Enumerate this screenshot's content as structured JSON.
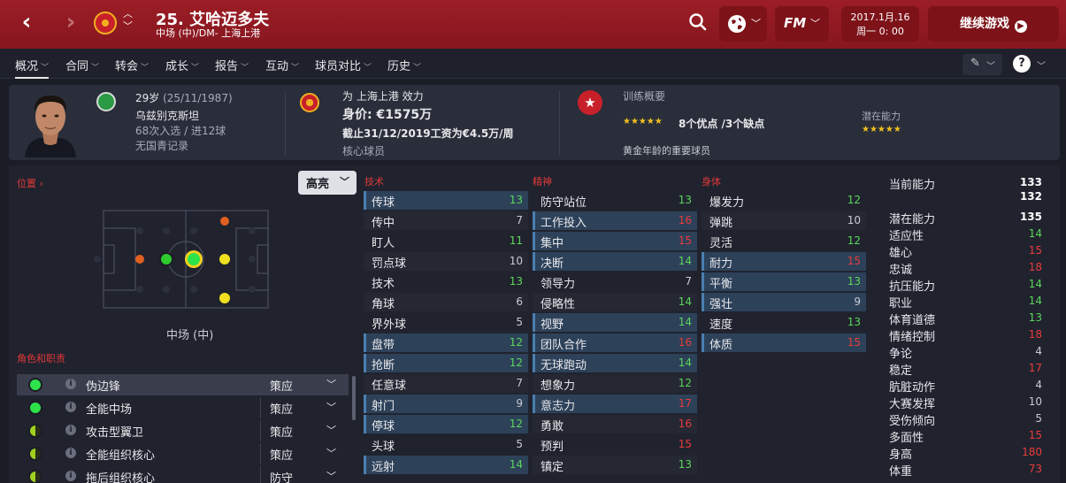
{
  "header": {
    "player_title": "25. 艾哈迈多夫",
    "player_subtitle": "中场 (中)/DM- 上海上港",
    "date_line1": "2017.1月.16",
    "date_line2": "周一 0: 00",
    "continue_label": "继续游戏",
    "fm_label": "FM"
  },
  "menu": {
    "items": [
      "概况",
      "合同",
      "转会",
      "成长",
      "报告",
      "互动",
      "球员对比",
      "历史"
    ],
    "active": "概况"
  },
  "info": {
    "age": "29岁",
    "dob": "(25/11/1987)",
    "nationality": "乌兹别克斯坦",
    "caps": "68次入选 / 进12球",
    "youth": "无国青记录",
    "club_line": "为 上海上港 效力",
    "value": "身价: €1575万",
    "contract": "截止31/12/2019工资为€4.5万/周",
    "squad_status": "核心球员",
    "training_title": "训练概要",
    "traits": "8个优点 /3个缺点",
    "potential_label": "潜在能力",
    "importance": "黄金年龄的重要球员",
    "current_stars": 4.5,
    "potential_stars": 4.5
  },
  "position": {
    "label": "位置",
    "highlight": "高亮",
    "position_name": "中场 (中)"
  },
  "roles": {
    "title": "角色和职责",
    "items": [
      {
        "name": "伪边锋",
        "duty": "策应",
        "color": "#2ee24a"
      },
      {
        "name": "全能中场",
        "duty": "策应",
        "color": "#2ee24a"
      },
      {
        "name": "攻击型翼卫",
        "duty": "策应",
        "color": "#a0d020"
      },
      {
        "name": "全能组织核心",
        "duty": "策应",
        "color": "#a0d020"
      },
      {
        "name": "拖后组织核心",
        "duty": "防守",
        "color": "#a0d020"
      }
    ]
  },
  "attributes": {
    "technical_title": "技术",
    "mental_title": "精神",
    "physical_title": "身体",
    "technical": [
      {
        "name": "传球",
        "value": "13",
        "hl": true
      },
      {
        "name": "传中",
        "value": "7",
        "hl": false
      },
      {
        "name": "盯人",
        "value": "11",
        "hl": false
      },
      {
        "name": "罚点球",
        "value": "10",
        "hl": false
      },
      {
        "name": "技术",
        "value": "13",
        "hl": false
      },
      {
        "name": "角球",
        "value": "6",
        "hl": false
      },
      {
        "name": "界外球",
        "value": "5",
        "hl": false
      },
      {
        "name": "盘带",
        "value": "12",
        "hl": true
      },
      {
        "name": "抢断",
        "value": "12",
        "hl": true
      },
      {
        "name": "任意球",
        "value": "7",
        "hl": false
      },
      {
        "name": "射门",
        "value": "9",
        "hl": true
      },
      {
        "name": "停球",
        "value": "12",
        "hl": true
      },
      {
        "name": "头球",
        "value": "5",
        "hl": false
      },
      {
        "name": "远射",
        "value": "14",
        "hl": true
      }
    ],
    "mental": [
      {
        "name": "防守站位",
        "value": "13",
        "hl": false
      },
      {
        "name": "工作投入",
        "value": "16",
        "hl": true
      },
      {
        "name": "集中",
        "value": "15",
        "hl": true
      },
      {
        "name": "决断",
        "value": "14",
        "hl": true
      },
      {
        "name": "领导力",
        "value": "7",
        "hl": false
      },
      {
        "name": "侵略性",
        "value": "14",
        "hl": false
      },
      {
        "name": "视野",
        "value": "14",
        "hl": true
      },
      {
        "name": "团队合作",
        "value": "16",
        "hl": true
      },
      {
        "name": "无球跑动",
        "value": "14",
        "hl": true
      },
      {
        "name": "想象力",
        "value": "12",
        "hl": false
      },
      {
        "name": "意志力",
        "value": "17",
        "hl": true
      },
      {
        "name": "勇敢",
        "value": "16",
        "hl": false
      },
      {
        "name": "预判",
        "value": "15",
        "hl": false
      },
      {
        "name": "镇定",
        "value": "13",
        "hl": false
      }
    ],
    "physical": [
      {
        "name": "爆发力",
        "value": "12",
        "hl": false
      },
      {
        "name": "弹跳",
        "value": "10",
        "hl": false
      },
      {
        "name": "灵活",
        "value": "12",
        "hl": false
      },
      {
        "name": "耐力",
        "value": "15",
        "hl": true
      },
      {
        "name": "平衡",
        "value": "13",
        "hl": true
      },
      {
        "name": "强壮",
        "value": "9",
        "hl": true
      },
      {
        "name": "速度",
        "value": "13",
        "hl": false
      },
      {
        "name": "体质",
        "value": "15",
        "hl": true
      }
    ]
  },
  "hidden": [
    {
      "name": "当前能力",
      "value": "133",
      "extra": "132"
    },
    {
      "name": "潜在能力",
      "value": "135"
    },
    {
      "name": "适应性",
      "value": "14"
    },
    {
      "name": "雄心",
      "value": "15"
    },
    {
      "name": "忠诚",
      "value": "18"
    },
    {
      "name": "抗压能力",
      "value": "14"
    },
    {
      "name": "职业",
      "value": "14"
    },
    {
      "name": "体育道德",
      "value": "13"
    },
    {
      "name": "情绪控制",
      "value": "18"
    },
    {
      "name": "争论",
      "value": "4"
    },
    {
      "name": "稳定",
      "value": "17"
    },
    {
      "name": "肮脏动作",
      "value": "4"
    },
    {
      "name": "大赛发挥",
      "value": "10"
    },
    {
      "name": "受伤倾向",
      "value": "5"
    },
    {
      "name": "多面性",
      "value": "15"
    },
    {
      "name": "身高",
      "value": "180"
    },
    {
      "name": "体重",
      "value": "73"
    }
  ],
  "colors": {
    "red": "#e83c3c",
    "green": "#5cd65c",
    "gray": "#c8cad2",
    "header_red": "#9c1d25"
  }
}
